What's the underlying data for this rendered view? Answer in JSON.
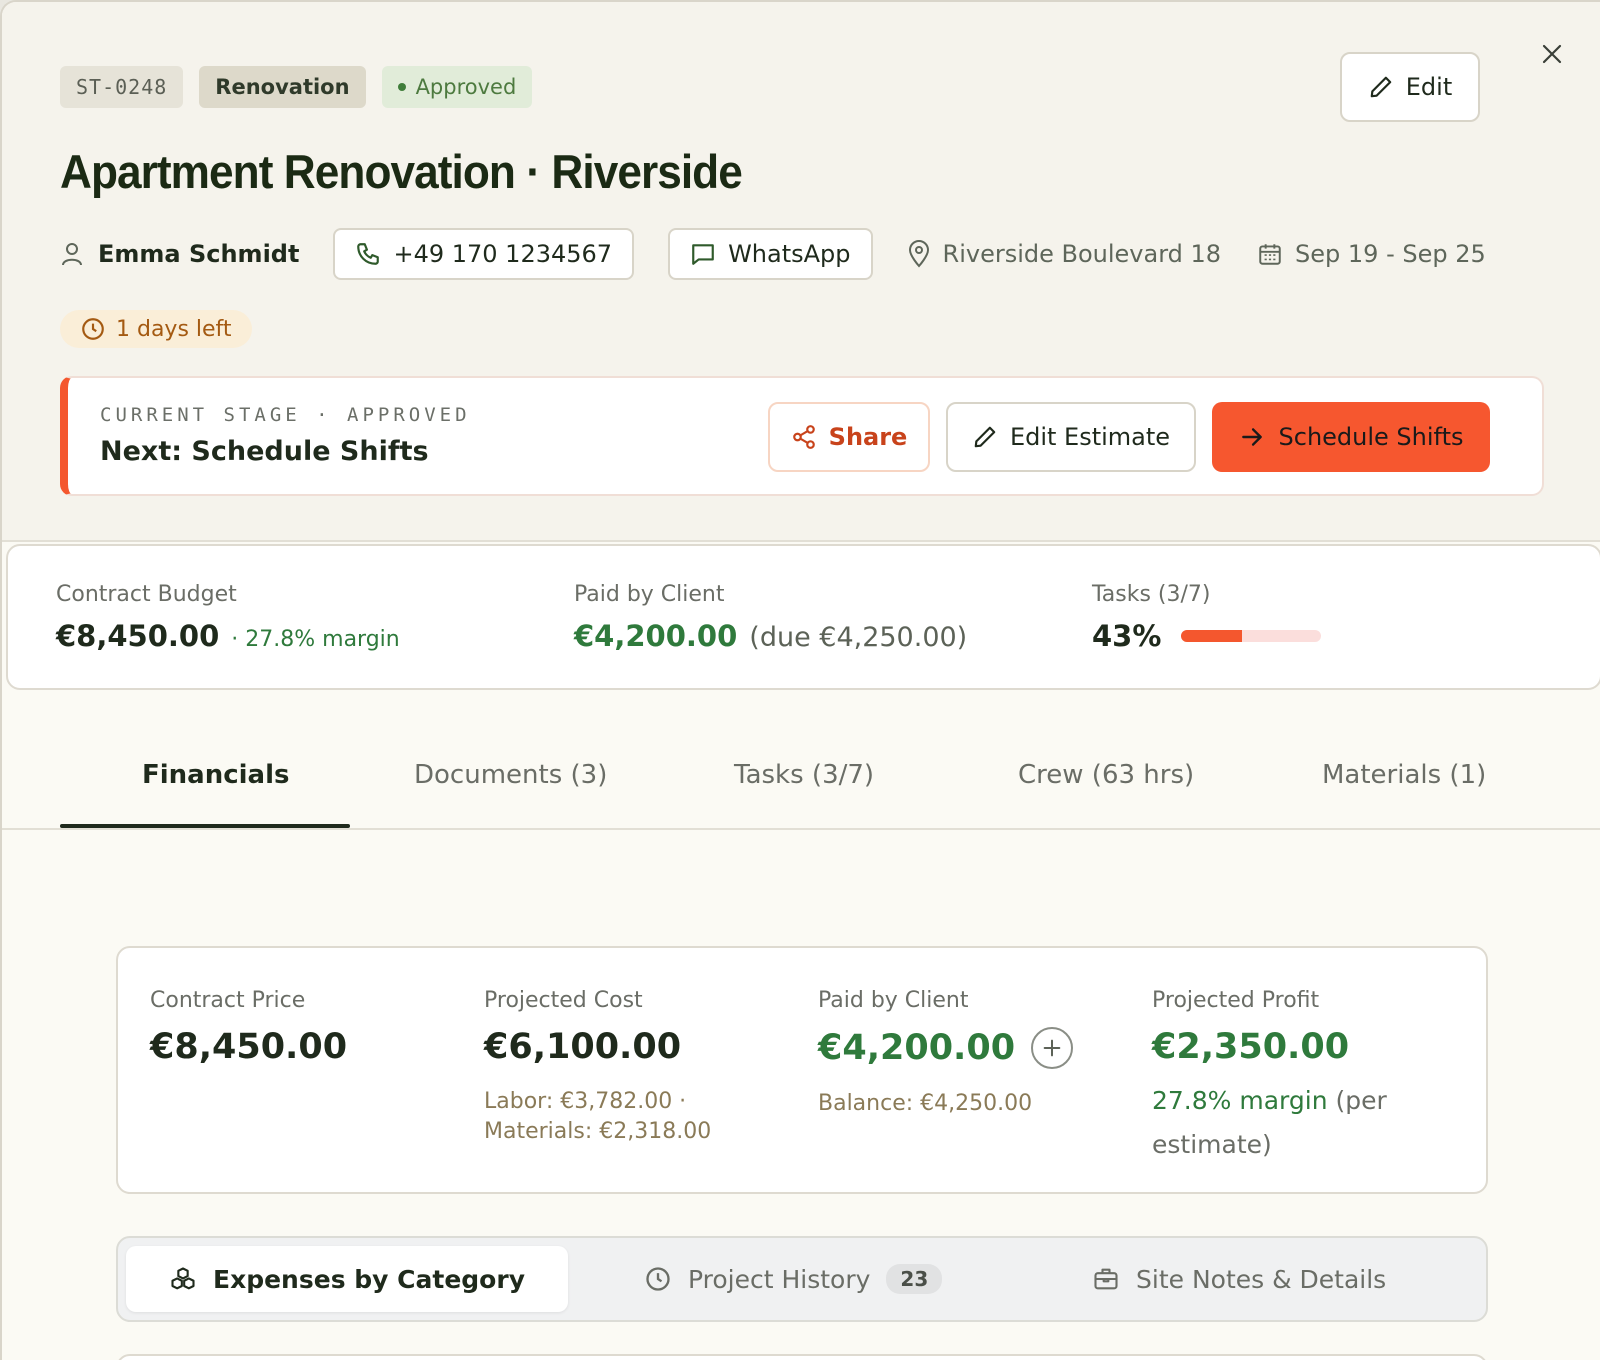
{
  "header": {
    "project_id": "ST-0248",
    "type": "Renovation",
    "status": "Approved",
    "edit_label": "Edit",
    "title": "Apartment Renovation · Riverside",
    "client_name": "Emma Schmidt",
    "phone": "+49 170 1234567",
    "whatsapp_label": "WhatsApp",
    "address": "Riverside Boulevard 18",
    "date_range": "Sep 19 - Sep 25",
    "days_left": "1 days left"
  },
  "stage": {
    "label": "CURRENT STAGE · APPROVED",
    "next": "Next: Schedule Shifts",
    "share_label": "Share",
    "edit_estimate_label": "Edit Estimate",
    "schedule_label": "Schedule Shifts"
  },
  "summary": {
    "budget_label": "Contract Budget",
    "budget_value": "€8,450.00",
    "budget_margin": "· 27.8% margin",
    "paid_label": "Paid by Client",
    "paid_value": "€4,200.00",
    "paid_due": "(due €4,250.00)",
    "tasks_label": "Tasks (3/7)",
    "tasks_percent": "43%",
    "tasks_progress": 0.43
  },
  "tabs": [
    {
      "label": "Financials",
      "active": true
    },
    {
      "label": "Documents (3)",
      "active": false
    },
    {
      "label": "Tasks (3/7)",
      "active": false
    },
    {
      "label": "Crew (63 hrs)",
      "active": false
    },
    {
      "label": "Materials (1)",
      "active": false
    }
  ],
  "financials": {
    "contract_price_label": "Contract Price",
    "contract_price_value": "€8,450.00",
    "projected_cost_label": "Projected Cost",
    "projected_cost_value": "€6,100.00",
    "projected_cost_labor": "Labor: €3,782.00 ·",
    "projected_cost_materials": "Materials: €2,318.00",
    "paid_label": "Paid by Client",
    "paid_value": "€4,200.00",
    "paid_balance": "Balance: €4,250.00",
    "profit_label": "Projected Profit",
    "profit_value": "€2,350.00",
    "profit_margin": "27.8% margin",
    "profit_note": "(per estimate)"
  },
  "subtabs": [
    {
      "label": "Expenses by Category",
      "icon": "cubes-icon",
      "active": true
    },
    {
      "label": "Project History",
      "icon": "clock-icon",
      "count": "23",
      "active": false
    },
    {
      "label": "Site Notes & Details",
      "icon": "briefcase-icon",
      "active": false
    }
  ],
  "colors": {
    "accent": "#f4572e",
    "green": "#2f7a3c",
    "dark": "#1f2a1c"
  }
}
